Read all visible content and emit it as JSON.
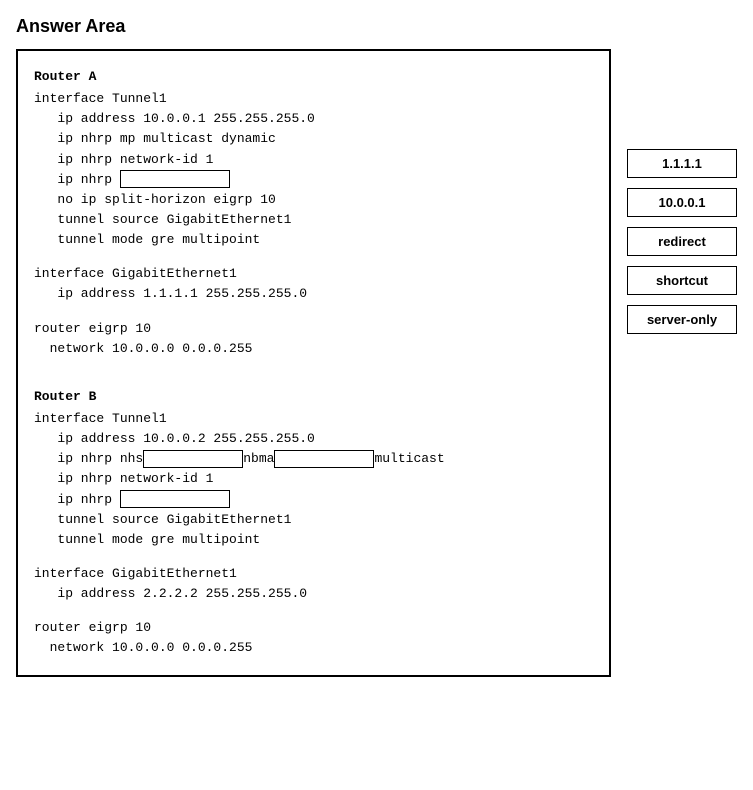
{
  "page": {
    "title": "Answer Area"
  },
  "answer_box": {
    "router_a": {
      "title": "Router A",
      "lines": [
        "interface Tunnel1",
        "   ip address 10.0.0.1 255.255.255.0",
        "   ip nhrp mp multicast dynamic",
        "   ip nhrp network-id 1",
        "   ip nhrp ",
        "   no ip split-horizon eigrp 10",
        "   tunnel source GigabitEthernet1",
        "   tunnel mode gre multipoint"
      ],
      "interface_ge1_title": "interface GigabitEthernet1",
      "interface_ge1_ip": "   ip address 1.1.1.1 255.255.255.0",
      "eigrp_title": "router eigrp 10",
      "eigrp_network": "  network 10.0.0.0 0.0.0.255"
    },
    "router_b": {
      "title": "Router B",
      "lines": [
        "interface Tunnel1",
        "   ip address 10.0.0.2 255.255.255.0"
      ],
      "nhs_line_prefix": "   ip nhrp nhs",
      "nhs_nbma_label": "nbma",
      "nhs_multicast": "multicast",
      "network_id_line": "   ip nhrp network-id 1",
      "nhrp_line_prefix": "   ip nhrp ",
      "tunnel_source": "   tunnel source GigabitEthernet1",
      "tunnel_mode": "   tunnel mode gre multipoint",
      "interface_ge1_title": "interface GigabitEthernet1",
      "interface_ge1_ip": "   ip address 2.2.2.2 255.255.255.0",
      "eigrp_title": "router eigrp 10",
      "eigrp_network": "  network 10.0.0.0 0.0.0.255"
    }
  },
  "sidebar": {
    "chips": [
      {
        "id": "chip-1",
        "label": "1.1.1.1"
      },
      {
        "id": "chip-2",
        "label": "10.0.0.1"
      },
      {
        "id": "chip-3",
        "label": "redirect"
      },
      {
        "id": "chip-4",
        "label": "shortcut"
      },
      {
        "id": "chip-5",
        "label": "server-only"
      }
    ]
  }
}
